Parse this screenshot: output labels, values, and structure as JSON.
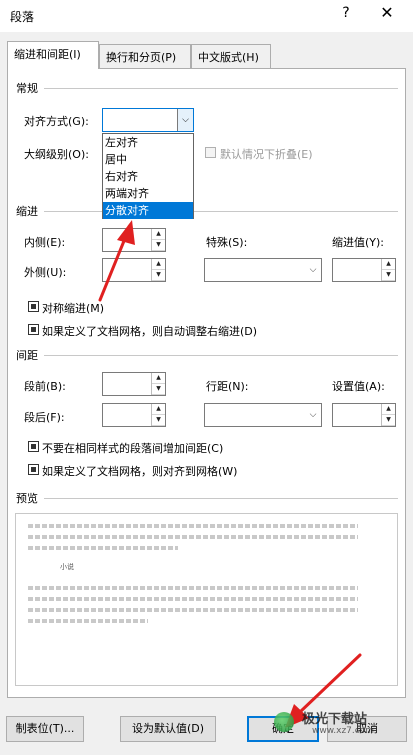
{
  "dialog": {
    "title": "段落",
    "help": "?",
    "close": "✕"
  },
  "tabs": [
    {
      "label": "缩进和间距(I)"
    },
    {
      "label": "换行和分页(P)"
    },
    {
      "label": "中文版式(H)"
    }
  ],
  "general": {
    "section": "常规",
    "alignment_label": "对齐方式(G):",
    "alignment_value": "",
    "outline_label": "大纲级别(O):",
    "collapse_label": "默认情况下折叠(E)"
  },
  "alignment_options": [
    "左对齐",
    "居中",
    "右对齐",
    "两端对齐",
    "分散对齐"
  ],
  "indent": {
    "section": "缩进",
    "inside_label": "内侧(E):",
    "outside_label": "外侧(U):",
    "special_label": "特殊(S):",
    "indent_by_label": "缩进值(Y):",
    "mirror_label": "对称缩进(M)",
    "grid_adjust_label": "如果定义了文档网格，则自动调整右缩进(D)"
  },
  "spacing": {
    "section": "间距",
    "before_label": "段前(B):",
    "after_label": "段后(F):",
    "line_label": "行距(N):",
    "at_label": "设置值(A):",
    "no_space_label": "不要在相同样式的段落间增加间距(C)",
    "snap_grid_label": "如果定义了文档网格，则对齐到网格(W)"
  },
  "preview": {
    "section": "预览",
    "sample": "小说"
  },
  "buttons": {
    "tabs": "制表位(T)...",
    "set_default": "设为默认值(D)",
    "ok": "确定",
    "cancel": "取消"
  },
  "watermark": {
    "text": "极光下载站",
    "url": "www.xz7.com"
  },
  "colors": {
    "accent": "#0078d7",
    "annotation_arrow": "#e02020"
  }
}
